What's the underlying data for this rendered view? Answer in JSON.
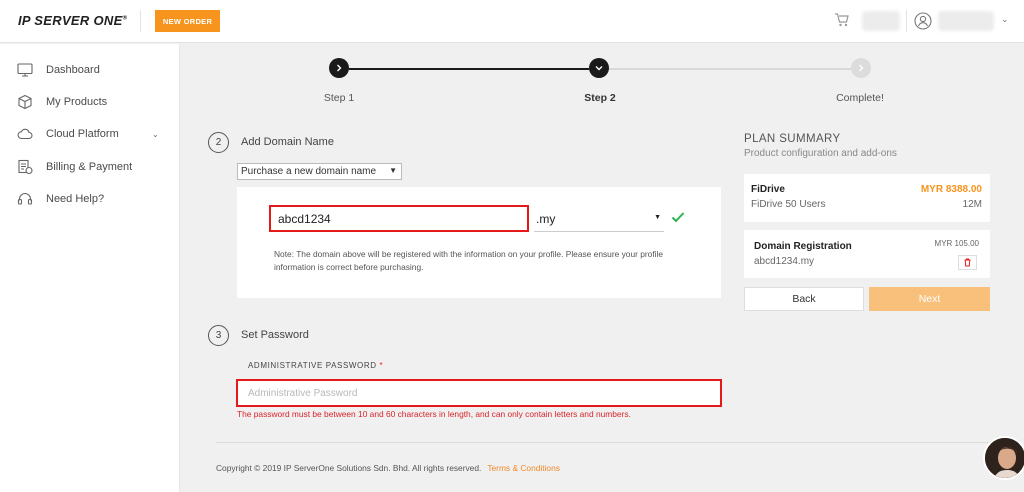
{
  "header": {
    "logo_text": "IP SERVER ONE",
    "logo_mark": "®",
    "new_order_label": "NEW ORDER"
  },
  "sidebar": {
    "items": [
      {
        "label": "Dashboard",
        "icon": "monitor-icon"
      },
      {
        "label": "My Products",
        "icon": "box-icon"
      },
      {
        "label": "Cloud Platform",
        "icon": "cloud-icon",
        "has_submenu": true
      },
      {
        "label": "Billing & Payment",
        "icon": "billing-icon"
      },
      {
        "label": "Need Help?",
        "icon": "headset-icon"
      }
    ]
  },
  "stepper": {
    "steps": [
      {
        "label": "Step 1",
        "state": "done"
      },
      {
        "label": "Step 2",
        "state": "current"
      },
      {
        "label": "Complete!",
        "state": "pending"
      }
    ]
  },
  "domain_section": {
    "number": "2",
    "title": "Add Domain Name",
    "mode_select": "Purchase a new domain name",
    "domain_value": "abcd1234",
    "tld_value": ".my",
    "note": "Note: The domain above will be registered with the information on your profile. Please ensure your profile information is correct before purchasing."
  },
  "password_section": {
    "number": "3",
    "title": "Set Password",
    "label": "ADMINISTRATIVE PASSWORD",
    "required_mark": "*",
    "placeholder": "Administrative Password",
    "error": "The password must be between 10 and 60 characters in length, and can only contain letters and numbers."
  },
  "plan_summary": {
    "title": "PLAN SUMMARY",
    "subtitle": "Product configuration and add-ons",
    "product": {
      "name": "FiDrive",
      "price": "MYR 8388.00",
      "detail": "FiDrive 50 Users",
      "term": "12M"
    },
    "addon": {
      "name": "Domain Registration",
      "price": "MYR 105.00",
      "detail": "abcd1234.my"
    },
    "back_label": "Back",
    "next_label": "Next"
  },
  "footer": {
    "copyright": "Copyright © 2019 IP ServerOne Solutions Sdn. Bhd. All rights reserved.",
    "terms_label": "Terms & Conditions"
  },
  "colors": {
    "accent": "#f7941d",
    "error": "#e41a1a",
    "success": "#2bb24c"
  }
}
